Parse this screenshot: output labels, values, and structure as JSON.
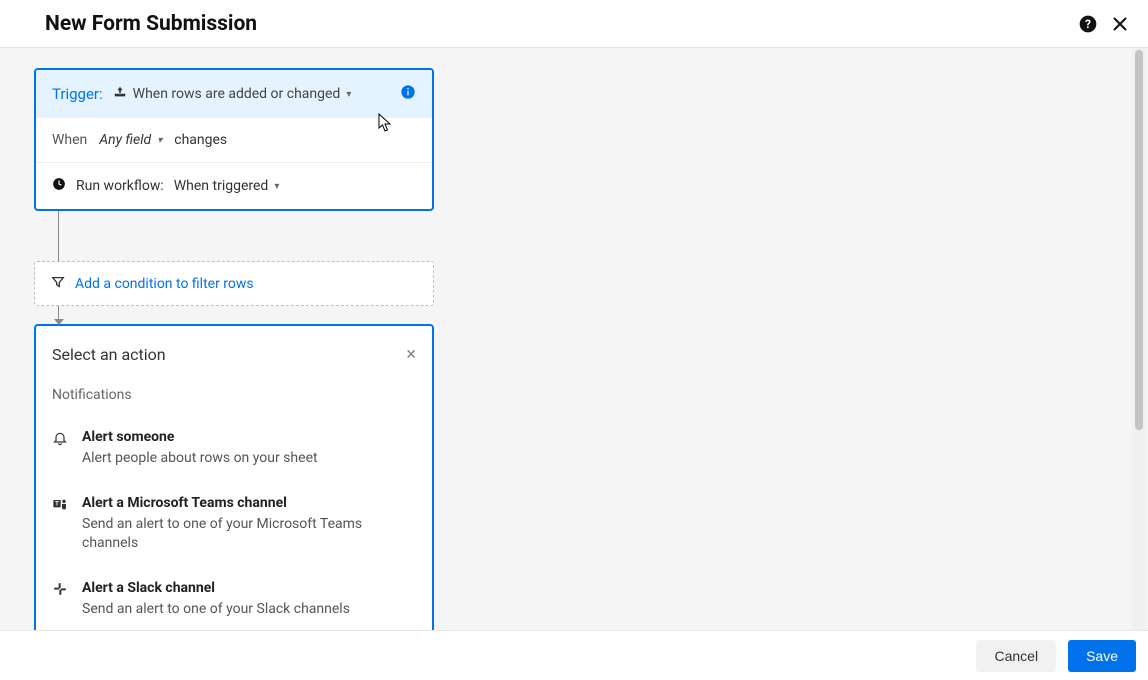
{
  "header": {
    "title": "New Form Submission"
  },
  "trigger": {
    "label": "Trigger:",
    "type_text": "When rows are added or changed",
    "when_label": "When",
    "field_text": "Any field",
    "changes_label": "changes",
    "run_label": "Run workflow:",
    "run_value": "When triggered"
  },
  "condition": {
    "link_text": "Add a condition to filter rows"
  },
  "action_panel": {
    "title": "Select an action",
    "section": "Notifications",
    "items": [
      {
        "title": "Alert someone",
        "desc": "Alert people about rows on your sheet"
      },
      {
        "title": "Alert a Microsoft Teams channel",
        "desc": "Send an alert to one of your Microsoft Teams channels"
      },
      {
        "title": "Alert a Slack channel",
        "desc": "Send an alert to one of your Slack channels"
      }
    ]
  },
  "footer": {
    "cancel": "Cancel",
    "save": "Save"
  }
}
